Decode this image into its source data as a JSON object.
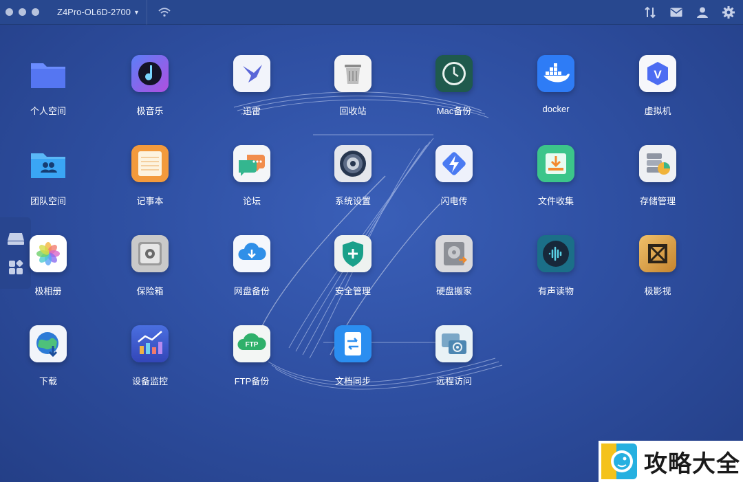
{
  "titlebar": {
    "device_name": "Z4Pro-OL6D-2700"
  },
  "top_icons": [
    "sort-icon",
    "mail-icon",
    "user-icon",
    "settings-icon"
  ],
  "side_dock": [
    "drive-icon",
    "apps-grid-icon"
  ],
  "apps": [
    {
      "label": "个人空间",
      "icon": "folder-icon",
      "color": "#5b7ef5"
    },
    {
      "label": "极音乐",
      "icon": "music-icon",
      "color": "#7a5cf0"
    },
    {
      "label": "迅雷",
      "icon": "thunder-bird-icon",
      "color": "#f2f4fb"
    },
    {
      "label": "回收站",
      "icon": "trash-icon",
      "color": "#f4f4f4"
    },
    {
      "label": "Mac备份",
      "icon": "time-machine-icon",
      "color": "#1f5a4d"
    },
    {
      "label": "docker",
      "icon": "docker-icon",
      "color": "#2e7cf6"
    },
    {
      "label": "虚拟机",
      "icon": "vm-icon",
      "color": "#f6f7fb"
    },
    {
      "label": "团队空间",
      "icon": "team-folder-icon",
      "color": "#3aa6f5"
    },
    {
      "label": "记事本",
      "icon": "notepad-icon",
      "color": "#f39a3c"
    },
    {
      "label": "论坛",
      "icon": "forum-icon",
      "color": "#f4f6f8"
    },
    {
      "label": "系统设置",
      "icon": "system-settings-icon",
      "color": "#e5e7ec"
    },
    {
      "label": "闪电传",
      "icon": "lightning-transfer-icon",
      "color": "#eef1fb"
    },
    {
      "label": "文件收集",
      "icon": "file-collect-icon",
      "color": "#3cc58a"
    },
    {
      "label": "存储管理",
      "icon": "storage-manage-icon",
      "color": "#eef0f3"
    },
    {
      "label": "极相册",
      "icon": "photos-icon",
      "color": "#ffffff"
    },
    {
      "label": "保险箱",
      "icon": "safe-icon",
      "color": "#c9c9c9"
    },
    {
      "label": "网盘备份",
      "icon": "cloud-backup-icon",
      "color": "#f4f7fc"
    },
    {
      "label": "安全管理",
      "icon": "security-shield-icon",
      "color": "#eef2f0"
    },
    {
      "label": "硬盘搬家",
      "icon": "disk-move-icon",
      "color": "#d9d9dc"
    },
    {
      "label": "有声读物",
      "icon": "audiobook-icon",
      "color": "#1b6f88"
    },
    {
      "label": "极影视",
      "icon": "video-icon",
      "color": "#d9a04a"
    },
    {
      "label": "下载",
      "icon": "download-globe-icon",
      "color": "#f2f5fa"
    },
    {
      "label": "设备监控",
      "icon": "device-monitor-icon",
      "color": "#3c5ccf"
    },
    {
      "label": "FTP备份",
      "icon": "ftp-backup-icon",
      "color": "#f3f6f4"
    },
    {
      "label": "文档同步",
      "icon": "doc-sync-icon",
      "color": "#2b8ef0"
    },
    {
      "label": "远程访问",
      "icon": "remote-access-icon",
      "color": "#e9f2f6"
    }
  ],
  "watermark": {
    "text": "攻略大全"
  }
}
